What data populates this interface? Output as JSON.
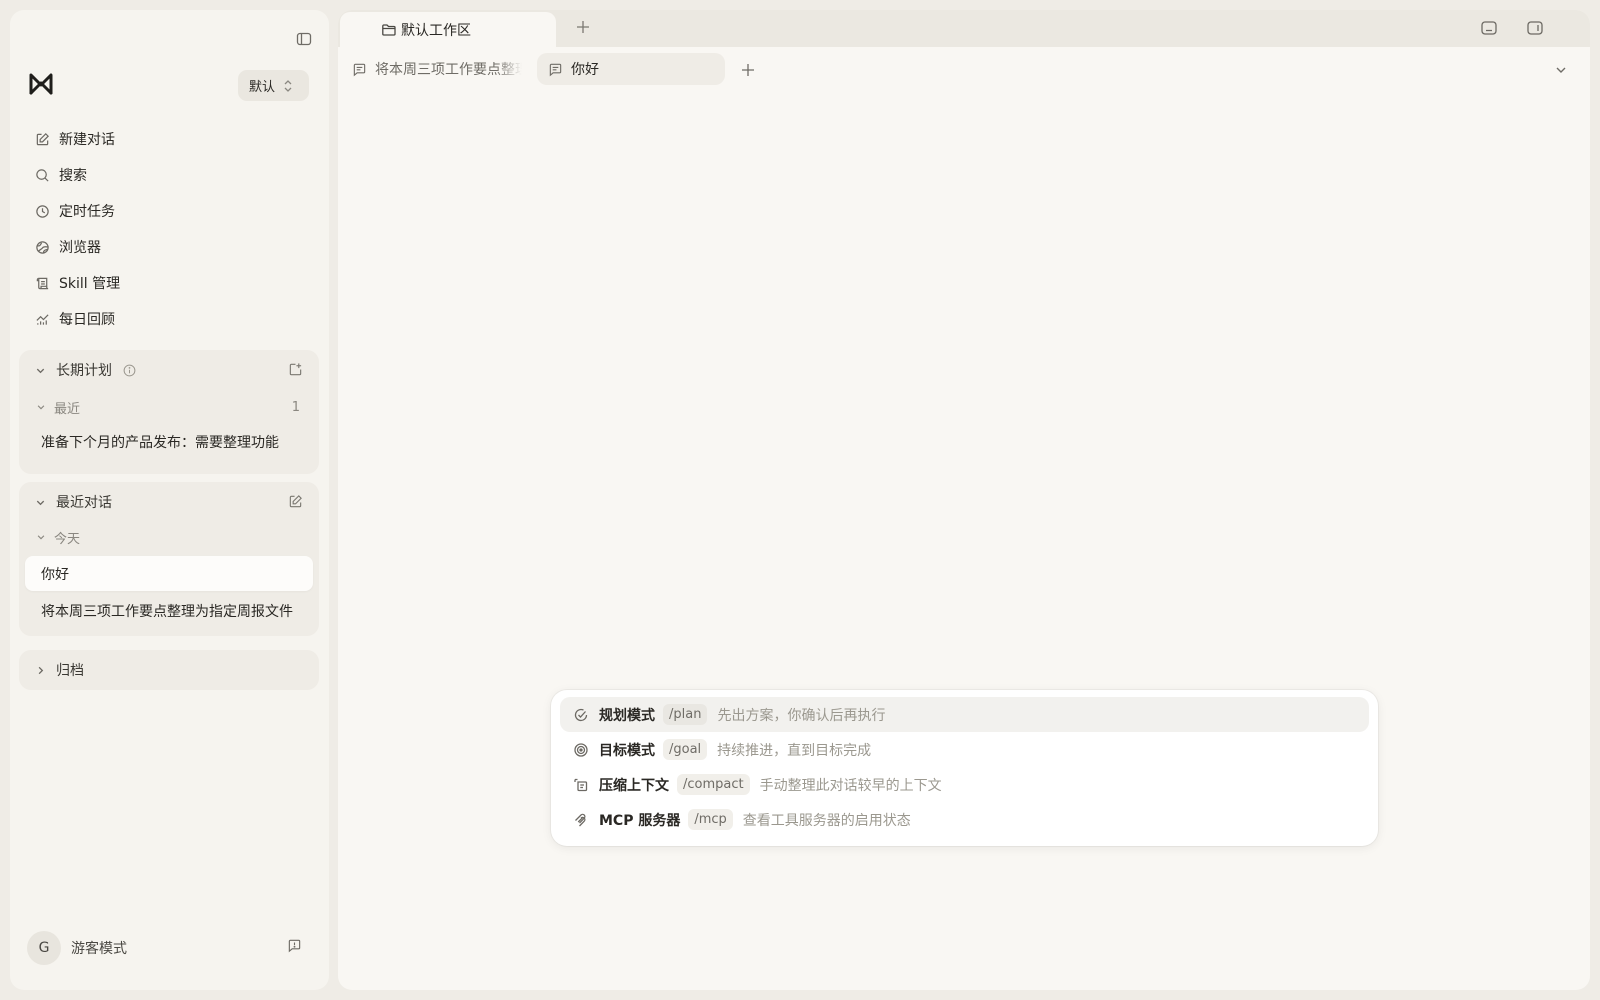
{
  "sidebar": {
    "workspace_switch": "默认",
    "nav": [
      {
        "label": "新建对话",
        "icon": "edit-icon"
      },
      {
        "label": "搜索",
        "icon": "search-icon"
      },
      {
        "label": "定时任务",
        "icon": "clock-icon"
      },
      {
        "label": "浏览器",
        "icon": "globe-icon"
      },
      {
        "label": "Skill 管理",
        "icon": "scroll-icon"
      },
      {
        "label": "每日回顾",
        "icon": "chart-icon"
      }
    ],
    "long_term": {
      "title": "长期计划",
      "group_label": "最近",
      "group_count": "1",
      "items": [
        "准备下个月的产品发布：需要整理功能"
      ]
    },
    "recent": {
      "title": "最近对话",
      "group_label": "今天",
      "items": [
        "你好",
        "将本周三项工作要点整理为指定周报文件"
      ]
    },
    "archive": {
      "title": "归档"
    },
    "user": {
      "avatar_letter": "G",
      "name": "游客模式"
    }
  },
  "main": {
    "workspace_tab": "默认工作区",
    "chat_tabs": [
      {
        "label": "将本周三项工作要点整理为指定周报文件",
        "active": false
      },
      {
        "label": "你好",
        "active": true
      }
    ]
  },
  "commands": [
    {
      "name": "规划模式",
      "slash": "/plan",
      "desc": "先出方案，你确认后再执行",
      "icon": "check-circle-icon",
      "active": true
    },
    {
      "name": "目标模式",
      "slash": "/goal",
      "desc": "持续推进，直到目标完成",
      "icon": "target-icon",
      "active": false
    },
    {
      "name": "压缩上下文",
      "slash": "/compact",
      "desc": "手动整理此对话较早的上下文",
      "icon": "compress-icon",
      "active": false
    },
    {
      "name": "MCP 服务器",
      "slash": "/mcp",
      "desc": "查看工具服务器的启用状态",
      "icon": "server-icon",
      "active": false
    }
  ],
  "colors": {
    "background": "#efece6",
    "panel": "#f6f4ef",
    "main": "#f9f7f3",
    "popover": "#ffffff"
  }
}
